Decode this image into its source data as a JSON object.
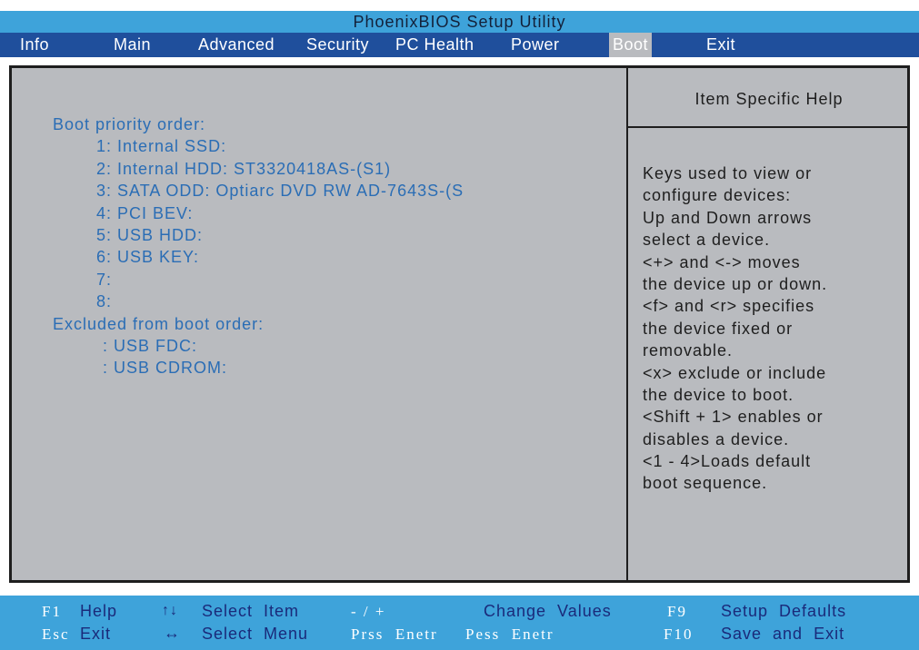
{
  "app": {
    "title": "PhoenixBIOS Setup Utility"
  },
  "menu": {
    "items": [
      {
        "label": "Info"
      },
      {
        "label": "Main"
      },
      {
        "label": "Advanced"
      },
      {
        "label": "Security"
      },
      {
        "label": "PC Health"
      },
      {
        "label": "Power"
      },
      {
        "label": "Boot",
        "selected": true
      },
      {
        "label": "Exit"
      }
    ]
  },
  "boot": {
    "priority_heading": "Boot priority order:",
    "priority": [
      "1: Internal SSD:",
      "2: Internal HDD: ST3320418AS-(S1)",
      "3: SATA ODD: Optiarc DVD RW AD-7643S-(S",
      "4: PCI BEV:",
      "5: USB HDD:",
      "6: USB KEY:",
      "7:",
      "8:"
    ],
    "excluded_heading": "Excluded from boot order:",
    "excluded": [
      ": USB FDC:",
      ": USB CDROM:"
    ]
  },
  "help": {
    "title": "Item Specific Help",
    "lines": [
      "Keys used to view or",
      "configure devices:",
      "Up and Down arrows",
      "select a device.",
      "<+> and <-> moves",
      "the device up or down.",
      "<f> and <r> specifies",
      "the device fixed or",
      "removable.",
      "<x> exclude or include",
      "the device to boot.",
      "<Shift + 1> enables or",
      "disables a device.",
      "<1 - 4>Loads default",
      "boot sequence."
    ]
  },
  "footer": {
    "f1_key": "F1",
    "f1_action": "Help",
    "updown_key": "↑↓",
    "updown_action": "Select  Item",
    "plusminus_key": "- / +",
    "plusminus_action": "Change  Values",
    "f9_key": "F9",
    "f9_action": "Setup  Defaults",
    "esc_key": "Esc",
    "esc_action": "Exit",
    "leftright_key": "↔",
    "leftright_action": "Select  Menu",
    "enter_key": "Prss  Enetr",
    "enter_action": "Pess  Enetr",
    "f10_key": "F10",
    "f10_action": "Save  and  Exit"
  },
  "colors": {
    "title_bar": "#3ea3da",
    "menu_bar": "#1f4f9c",
    "panel": "#b9bbbf",
    "boot_text": "#2a6db5",
    "footer": "#3ea3da"
  }
}
